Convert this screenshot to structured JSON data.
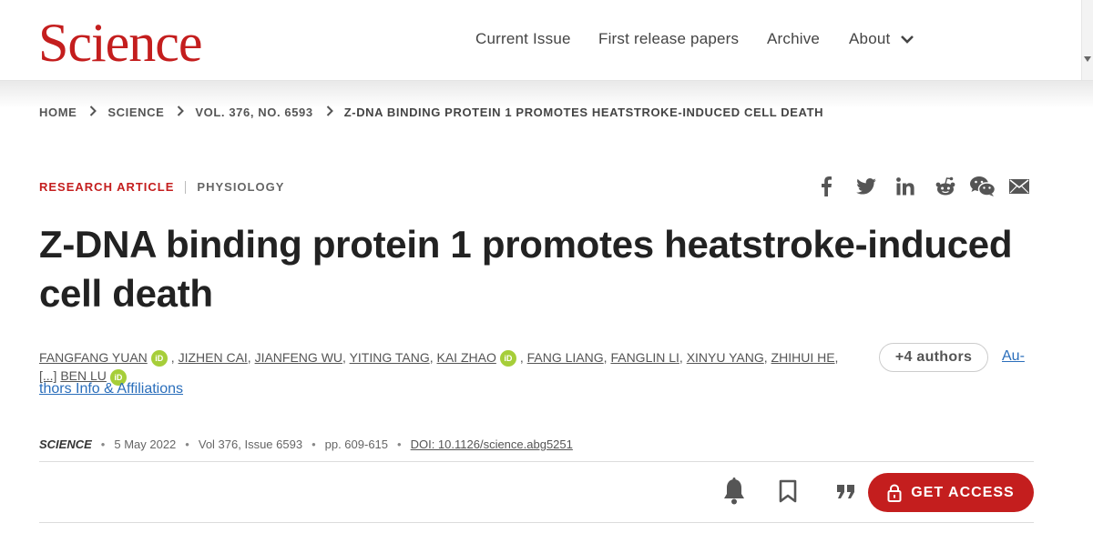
{
  "header": {
    "logo": "Science",
    "nav": [
      {
        "label": "Current Issue"
      },
      {
        "label": "First release papers"
      },
      {
        "label": "Archive"
      },
      {
        "label": "About"
      }
    ]
  },
  "breadcrumb": [
    "HOME",
    "SCIENCE",
    "VOL. 376, NO. 6593",
    "Z-DNA BINDING PROTEIN 1 PROMOTES HEATSTROKE-INDUCED CELL DEATH"
  ],
  "article": {
    "type": "RESEARCH ARTICLE",
    "subject": "PHYSIOLOGY",
    "title": "Z-DNA binding protein 1 promotes heatstroke-induced cell death",
    "authors": [
      "FANGFANG YUAN",
      "JIZHEN CAI",
      "JIANFENG WU",
      "YITING TANG",
      "KAI ZHAO",
      "FANG LIANG",
      "FANGLIN LI",
      "XINYU YANG",
      "ZHIHUI HE",
      "BEN LU"
    ],
    "ellipsis": "[...]",
    "more_authors": "+4 authors",
    "affiliations_part1": "Au-",
    "affiliations_part2": "thors Info & Affiliations"
  },
  "meta": {
    "journal": "SCIENCE",
    "date": "5 May 2022",
    "volume": "Vol 376, Issue 6593",
    "pages": "pp. 609-615",
    "doi": "DOI: 10.1126/science.abg5251"
  },
  "share_icons": [
    "facebook-icon",
    "twitter-icon",
    "linkedin-icon",
    "reddit-icon",
    "wechat-icon",
    "email-icon"
  ],
  "toolbar": {
    "access_label": "GET ACCESS"
  },
  "colors": {
    "brand": "#c41e1e",
    "link": "#2a6ebb",
    "orcid": "#a6ce39"
  }
}
